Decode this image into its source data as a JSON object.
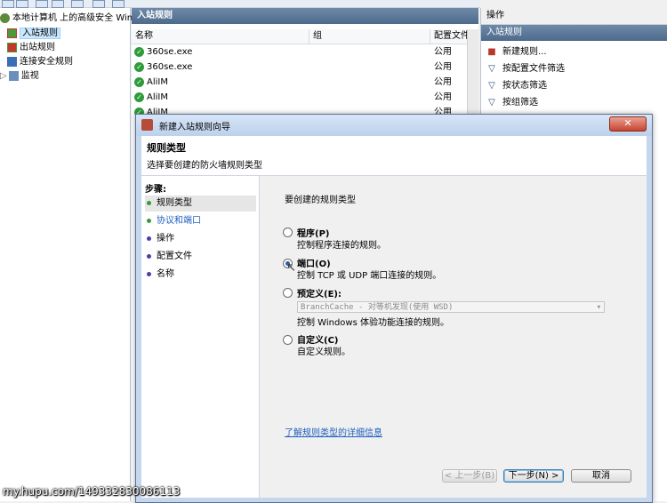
{
  "tree": {
    "root_label": "本地计算机 上的高级安全 Windo",
    "items": [
      {
        "label": "入站规则",
        "icon": "inbound-rules-icon"
      },
      {
        "label": "出站规则",
        "icon": "outbound-rules-icon"
      },
      {
        "label": "连接安全规则",
        "icon": "connection-security-icon"
      },
      {
        "label": "监视",
        "icon": "monitor-icon"
      }
    ]
  },
  "center": {
    "title": "入站规则",
    "columns": [
      "名称",
      "组",
      "配置文件"
    ],
    "rows": [
      {
        "name": "360se.exe",
        "profile": "公用"
      },
      {
        "name": "360se.exe",
        "profile": "公用"
      },
      {
        "name": "AliIM",
        "profile": "公用"
      },
      {
        "name": "AliIM",
        "profile": "公用"
      },
      {
        "name": "AliIM",
        "profile": "公用"
      }
    ]
  },
  "actions": {
    "title": "操作",
    "section": "入站规则",
    "items": [
      {
        "label": "新建规则...",
        "icon": "new-rule-icon"
      },
      {
        "label": "按配置文件筛选",
        "icon": "filter-icon"
      },
      {
        "label": "按状态筛选",
        "icon": "filter-icon"
      },
      {
        "label": "按组筛选",
        "icon": "filter-icon"
      }
    ]
  },
  "dialog": {
    "title": "新建入站规则向导",
    "close": "✕",
    "header_title": "规则类型",
    "header_subtitle": "选择要创建的防火墙规则类型",
    "steps_label": "步骤:",
    "steps": [
      {
        "label": "规则类型",
        "state": "current",
        "dot_color": "#3a9a3a"
      },
      {
        "label": "协议和端口",
        "state": "next",
        "dot_color": "#3a9a3a"
      },
      {
        "label": "操作",
        "state": "pending",
        "dot_color": "#4a3fa8"
      },
      {
        "label": "配置文件",
        "state": "pending",
        "dot_color": "#4a3fa8"
      },
      {
        "label": "名称",
        "state": "pending",
        "dot_color": "#4a3fa8"
      }
    ],
    "question": "要创建的规则类型",
    "options": [
      {
        "title": "程序(P)",
        "desc": "控制程序连接的规则。",
        "selected": false
      },
      {
        "title": "端口(O)",
        "desc": "控制 TCP 或 UDP 端口连接的规则。",
        "selected": true
      },
      {
        "title": "预定义(E):",
        "desc": "控制 Windows 体验功能连接的规则。",
        "selected": false
      },
      {
        "title": "自定义(C)",
        "desc": "自定义规则。",
        "selected": false
      }
    ],
    "predefined_value": "BranchCache - 对等机发现(使用 WSD)",
    "learn_more": "了解规则类型的详细信息",
    "buttons": {
      "back": "< 上一步(B)",
      "next": "下一步(N) >",
      "cancel": "取消"
    }
  },
  "watermark": "my.hupu.com/149332830086113"
}
